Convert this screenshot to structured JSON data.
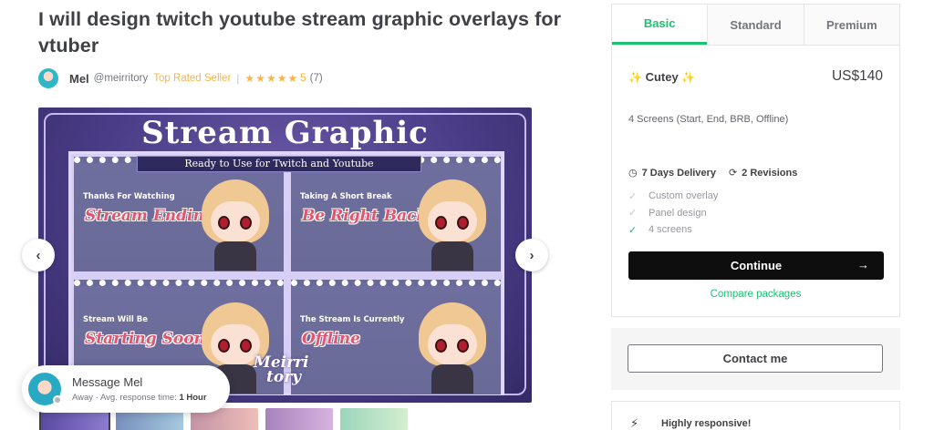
{
  "gig": {
    "title": "I will design twitch youtube stream graphic overlays for vtuber",
    "seller": {
      "name": "Mel",
      "handle": "@meirritory",
      "badge": "Top Rated Seller",
      "separator": "|",
      "stars": "★★★★★",
      "rating": "5",
      "review_count": "(7)"
    }
  },
  "gallery": {
    "image": {
      "title": "Stream Graphic",
      "ribbon": "Ready to Use for Twitch and Youtube",
      "panels": [
        {
          "small": "Thanks For Watching",
          "script": "Stream Ending"
        },
        {
          "small": "Taking A Short Break",
          "script": "Be Right Back"
        },
        {
          "small": "Stream Will Be",
          "script": "Starting Soon"
        },
        {
          "small": "The Stream Is Currently",
          "script": "Offline"
        }
      ],
      "logo_line1": "Meirri",
      "logo_line2": "tory"
    },
    "prev_icon": "‹",
    "next_icon": "›"
  },
  "message": {
    "title": "Message Mel",
    "status": "Away",
    "dot": "·",
    "response_label": "Avg. response time:",
    "response_value": "1 Hour"
  },
  "package": {
    "tabs": [
      "Basic",
      "Standard",
      "Premium"
    ],
    "active_tab": "Basic",
    "name": "Cutey",
    "price": "US$140",
    "description": "4 Screens (Start, End, BRB, Offline)",
    "delivery": "7 Days Delivery",
    "revisions": "2 Revisions",
    "features": [
      {
        "label": "Custom overlay",
        "included": false
      },
      {
        "label": "Panel design",
        "included": false
      },
      {
        "label": "4 screens",
        "included": true
      }
    ],
    "continue_label": "Continue",
    "continue_arrow": "→",
    "compare_label": "Compare packages"
  },
  "contact": {
    "label": "Contact me"
  },
  "responsive": {
    "label": "Highly responsive!"
  },
  "colors": {
    "accent": "#1dbf73",
    "star": "#ffb33e",
    "text": "#404145",
    "button_dark": "#0e0e0e"
  }
}
